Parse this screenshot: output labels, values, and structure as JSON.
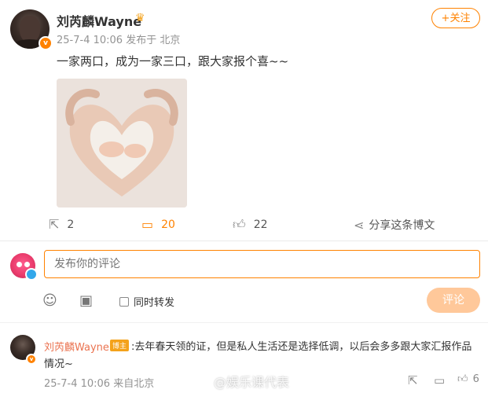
{
  "post": {
    "author": "刘芮麟Wayne",
    "meta": "25-7-4 10:06  发布于 北京",
    "follow_label": "+关注",
    "text": "一家两口，成为一家三口，跟大家报个喜~~",
    "image_desc_icon": "heart-hands-photo"
  },
  "actions": {
    "repost_count": "2",
    "comment_count": "20",
    "like_count": "22",
    "share_label": "分享这条博文"
  },
  "composer": {
    "placeholder": "发布你的评论",
    "repost_label": "同时转发",
    "submit_label": "评论"
  },
  "comment": {
    "author": "刘芮麟Wayne",
    "tag": "博主",
    "text": ":去年春天领的证，但是私人生活还是选择低调，以后会多多跟大家汇报作品",
    "text_cont": "情况~",
    "meta": "25-7-4 10:06  来自北京",
    "like_count": "6"
  },
  "watermark": "@娱乐课代表",
  "colors": {
    "accent": "#ff8200",
    "name_orange": "#eb7350"
  }
}
